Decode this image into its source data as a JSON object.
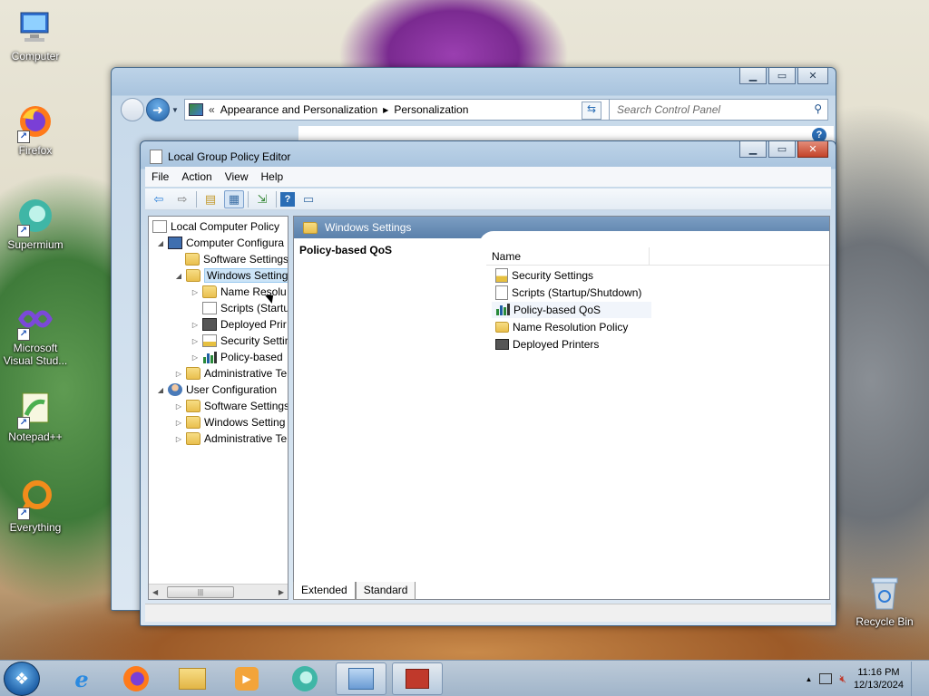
{
  "desktop": {
    "icons": [
      {
        "label": "Computer"
      },
      {
        "label": "Firefox"
      },
      {
        "label": "Supermium"
      },
      {
        "label": "Microsoft Visual Stud..."
      },
      {
        "label": "Notepad++"
      },
      {
        "label": "Everything"
      },
      {
        "label": "Recycle Bin"
      }
    ]
  },
  "control_panel": {
    "breadcrumb": [
      "Appearance and Personalization",
      "Personalization"
    ],
    "breadcrumb_prefix": "«",
    "search_placeholder": "Search Control Panel"
  },
  "gpedit": {
    "title": "Local Group Policy Editor",
    "menu": [
      "File",
      "Action",
      "View",
      "Help"
    ],
    "tree": [
      {
        "label": "Local Computer Policy"
      },
      {
        "label": "Computer Configura"
      },
      {
        "label": "Software Settings"
      },
      {
        "label": "Windows Setting"
      },
      {
        "label": "Name Resolu"
      },
      {
        "label": "Scripts (Startu"
      },
      {
        "label": "Deployed Prir"
      },
      {
        "label": "Security Settin"
      },
      {
        "label": "Policy-based"
      },
      {
        "label": "Administrative Te"
      },
      {
        "label": "User Configuration"
      },
      {
        "label": "Software Settings"
      },
      {
        "label": "Windows Setting"
      },
      {
        "label": "Administrative Te"
      }
    ],
    "right_header": "Windows Settings",
    "selected_title": "Policy-based QoS",
    "column_name": "Name",
    "items": [
      {
        "label": "Security Settings"
      },
      {
        "label": "Scripts (Startup/Shutdown)"
      },
      {
        "label": "Policy-based QoS"
      },
      {
        "label": "Name Resolution Policy"
      },
      {
        "label": "Deployed Printers"
      }
    ],
    "tabs": [
      "Extended",
      "Standard"
    ]
  },
  "taskbar": {
    "time": "11:16 PM",
    "date": "12/13/2024"
  },
  "colors": {
    "accent": "#5a80ab",
    "selection": "#cce4f7"
  }
}
